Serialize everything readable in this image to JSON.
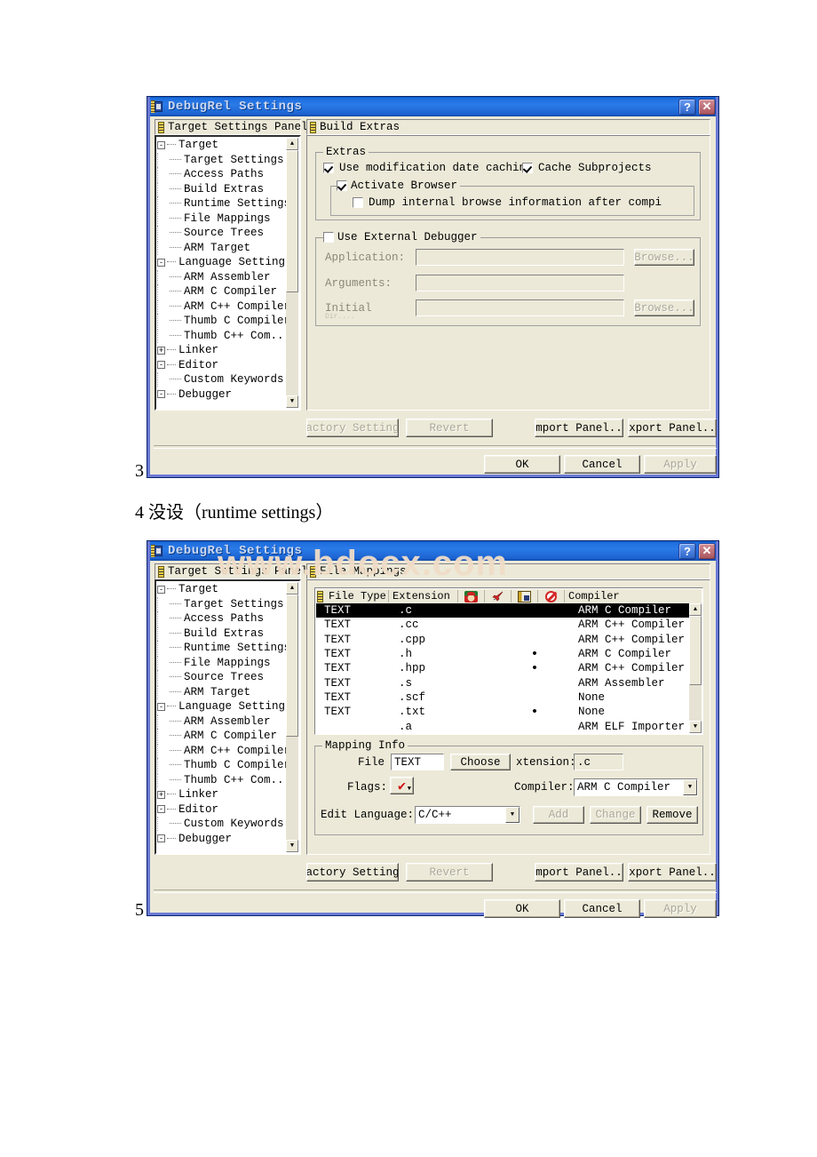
{
  "document": {
    "watermark": "www.bdocx.com",
    "marker_3": "3",
    "marker_5": "5",
    "caption_4": "4 没设（runtime settings）"
  },
  "dialog1": {
    "title": "DebugRel Settings",
    "title_icon": "project-document-icon",
    "help_button": "?",
    "close_button": "✕",
    "left_panel_header": "Target Settings Panels",
    "right_panel_header": "Build Extras",
    "tree": [
      {
        "label": "Target",
        "level": 0,
        "toggle": "-"
      },
      {
        "label": "Target Settings",
        "level": 1,
        "toggle": ""
      },
      {
        "label": "Access Paths",
        "level": 1,
        "toggle": ""
      },
      {
        "label": "Build Extras",
        "level": 1,
        "toggle": ""
      },
      {
        "label": "Runtime Settings",
        "level": 1,
        "toggle": ""
      },
      {
        "label": "File Mappings",
        "level": 1,
        "toggle": ""
      },
      {
        "label": "Source Trees",
        "level": 1,
        "toggle": ""
      },
      {
        "label": "ARM Target",
        "level": 1,
        "toggle": ""
      },
      {
        "label": "Language Settings",
        "level": 0,
        "toggle": "-"
      },
      {
        "label": "ARM Assembler",
        "level": 1,
        "toggle": ""
      },
      {
        "label": "ARM C Compiler",
        "level": 1,
        "toggle": ""
      },
      {
        "label": "ARM C++ Compiler",
        "level": 1,
        "toggle": ""
      },
      {
        "label": "Thumb C Compiler",
        "level": 1,
        "toggle": ""
      },
      {
        "label": "Thumb C++ Com...",
        "level": 1,
        "toggle": ""
      },
      {
        "label": "Linker",
        "level": 0,
        "toggle": "+"
      },
      {
        "label": "Editor",
        "level": 0,
        "toggle": "-"
      },
      {
        "label": "Custom Keywords",
        "level": 1,
        "toggle": ""
      },
      {
        "label": "Debugger",
        "level": 0,
        "toggle": "-"
      }
    ],
    "extras": {
      "group_label": "Extras",
      "use_mod_date_caching": {
        "label": "Use modification date caching",
        "checked": true
      },
      "cache_subprojects": {
        "label": "Cache Subprojects",
        "checked": true
      },
      "activate_browser": {
        "label": "Activate Browser",
        "checked": true
      },
      "dump_internal": {
        "label": "Dump internal browse information after compi",
        "checked": false
      }
    },
    "external_debugger": {
      "group_label": "Use External Debugger",
      "checked": false,
      "application_label": "Application:",
      "application_value": "",
      "application_browse": "Browse...",
      "arguments_label": "Arguments:",
      "arguments_value": "",
      "initial_label": "Initial",
      "initial_label2": "Dir....",
      "initial_value": "",
      "initial_browse": "Browse..."
    },
    "buttons": {
      "factory_settings": "Factory Settings",
      "revert": "Revert",
      "import_panel": "Import Panel...",
      "export_panel": "Export Panel...",
      "ok": "OK",
      "cancel": "Cancel",
      "apply": "Apply"
    }
  },
  "dialog2": {
    "title": "DebugRel Settings",
    "help_button": "?",
    "close_button": "✕",
    "left_panel_header": "Target Settings Panels",
    "right_panel_header": "File Mappings",
    "tree": [
      {
        "label": "Target",
        "level": 0,
        "toggle": "-"
      },
      {
        "label": "Target Settings",
        "level": 1,
        "toggle": ""
      },
      {
        "label": "Access Paths",
        "level": 1,
        "toggle": ""
      },
      {
        "label": "Build Extras",
        "level": 1,
        "toggle": ""
      },
      {
        "label": "Runtime Settings",
        "level": 1,
        "toggle": ""
      },
      {
        "label": "File Mappings",
        "level": 1,
        "toggle": ""
      },
      {
        "label": "Source Trees",
        "level": 1,
        "toggle": ""
      },
      {
        "label": "ARM Target",
        "level": 1,
        "toggle": ""
      },
      {
        "label": "Language Settings",
        "level": 0,
        "toggle": "-"
      },
      {
        "label": "ARM Assembler",
        "level": 1,
        "toggle": ""
      },
      {
        "label": "ARM C Compiler",
        "level": 1,
        "toggle": ""
      },
      {
        "label": "ARM C++ Compiler",
        "level": 1,
        "toggle": ""
      },
      {
        "label": "Thumb C Compiler",
        "level": 1,
        "toggle": ""
      },
      {
        "label": "Thumb C++ Com...",
        "level": 1,
        "toggle": ""
      },
      {
        "label": "Linker",
        "level": 0,
        "toggle": "+"
      },
      {
        "label": "Editor",
        "level": 0,
        "toggle": "-"
      },
      {
        "label": "Custom Keywords",
        "level": 1,
        "toggle": ""
      },
      {
        "label": "Debugger",
        "level": 0,
        "toggle": "-"
      }
    ],
    "table": {
      "columns": [
        {
          "label": "File Type",
          "icon": ""
        },
        {
          "label": "Extension",
          "icon": ""
        },
        {
          "label": "",
          "icon": "precompile-icon"
        },
        {
          "label": "",
          "icon": "launch-icon"
        },
        {
          "label": "",
          "icon": "resource-icon"
        },
        {
          "label": "",
          "icon": "ignore-icon"
        },
        {
          "label": "Compiler",
          "icon": ""
        }
      ],
      "rows": [
        {
          "file_type": "TEXT",
          "extension": ".c",
          "flag1": "",
          "flag2": "",
          "flag3": "",
          "flag4": "",
          "compiler": "ARM C Compiler",
          "selected": true
        },
        {
          "file_type": "TEXT",
          "extension": ".cc",
          "flag1": "",
          "flag2": "",
          "flag3": "",
          "flag4": "",
          "compiler": "ARM C++ Compiler",
          "selected": false
        },
        {
          "file_type": "TEXT",
          "extension": ".cpp",
          "flag1": "",
          "flag2": "",
          "flag3": "",
          "flag4": "",
          "compiler": "ARM C++ Compiler",
          "selected": false
        },
        {
          "file_type": "TEXT",
          "extension": ".h",
          "flag1": "",
          "flag2": "",
          "flag3": "•",
          "flag4": "",
          "compiler": "ARM C Compiler",
          "selected": false
        },
        {
          "file_type": "TEXT",
          "extension": ".hpp",
          "flag1": "",
          "flag2": "",
          "flag3": "•",
          "flag4": "",
          "compiler": "ARM C++ Compiler",
          "selected": false
        },
        {
          "file_type": "TEXT",
          "extension": ".s",
          "flag1": "",
          "flag2": "",
          "flag3": "",
          "flag4": "",
          "compiler": "ARM Assembler",
          "selected": false
        },
        {
          "file_type": "TEXT",
          "extension": ".scf",
          "flag1": "",
          "flag2": "",
          "flag3": "",
          "flag4": "",
          "compiler": "None",
          "selected": false
        },
        {
          "file_type": "TEXT",
          "extension": ".txt",
          "flag1": "",
          "flag2": "",
          "flag3": "•",
          "flag4": "",
          "compiler": "None",
          "selected": false
        },
        {
          "file_type": "",
          "extension": ".a",
          "flag1": "",
          "flag2": "",
          "flag3": "",
          "flag4": "",
          "compiler": "ARM ELF Importer",
          "selected": false
        }
      ]
    },
    "mapping_info": {
      "group_label": "Mapping Info",
      "file_label": "File",
      "file_value": "TEXT",
      "choose_button": "Choose",
      "extension_label": "xtension:",
      "extension_value": ".c",
      "flags_label": "Flags:",
      "flags_value": "✔",
      "compiler_label": "Compiler:",
      "compiler_value": "ARM C Compiler",
      "edit_language_label": "Edit Language:",
      "edit_language_value": "C/C++",
      "add_button": "Add",
      "change_button": "Change",
      "remove_button": "Remove"
    },
    "buttons": {
      "factory_settings": "Factory Settings",
      "revert": "Revert",
      "import_panel": "Import Panel...",
      "export_panel": "Export Panel...",
      "ok": "OK",
      "cancel": "Cancel",
      "apply": "Apply"
    }
  },
  "colors": {
    "titlebar_blue": "#1f6ede",
    "dialog_face": "#ece9d8",
    "dialog_border": "#6a79d4",
    "selection": "#000000",
    "watermark": "#f0ddc8"
  }
}
